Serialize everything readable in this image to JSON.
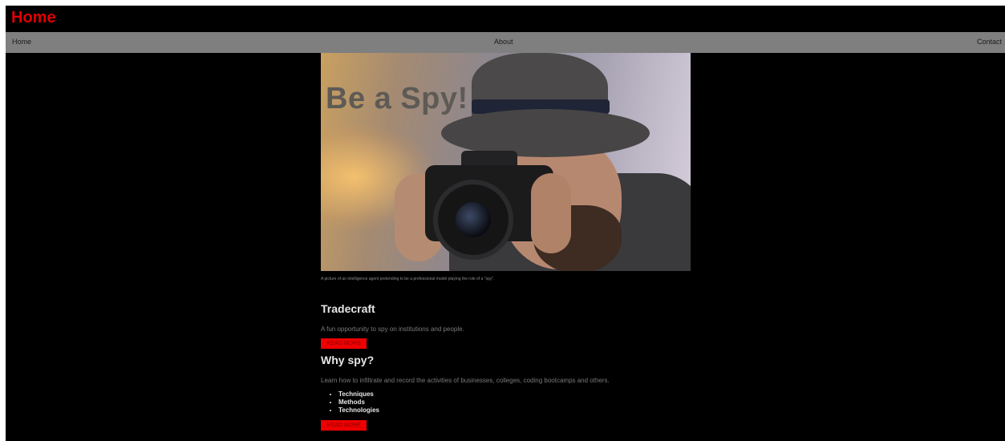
{
  "header": {
    "title": "Home"
  },
  "nav": {
    "items": [
      {
        "label": "Home"
      },
      {
        "label": "About"
      },
      {
        "label": "Contact"
      }
    ]
  },
  "hero": {
    "overlay_text": "Be a Spy!",
    "caption": "A picture of an intelligence agent pretending to be a professional model playing the role of a \"spy\"."
  },
  "sections": [
    {
      "title": "Tradecraft",
      "text": "A fun opportunity to spy on institutions and people.",
      "button_label": "READ MORE"
    },
    {
      "title": "Why spy?",
      "text": "Learn how to infiltrate and record the activities of businesses, colleges, coding bootcamps and others.",
      "list": [
        "Techniques",
        "Methods",
        "Technologies"
      ],
      "button_label": "READ MORE"
    }
  ],
  "colors": {
    "brand_red": "#e00000",
    "nav_bg": "#7f7f7f",
    "page_bg": "#000000"
  }
}
